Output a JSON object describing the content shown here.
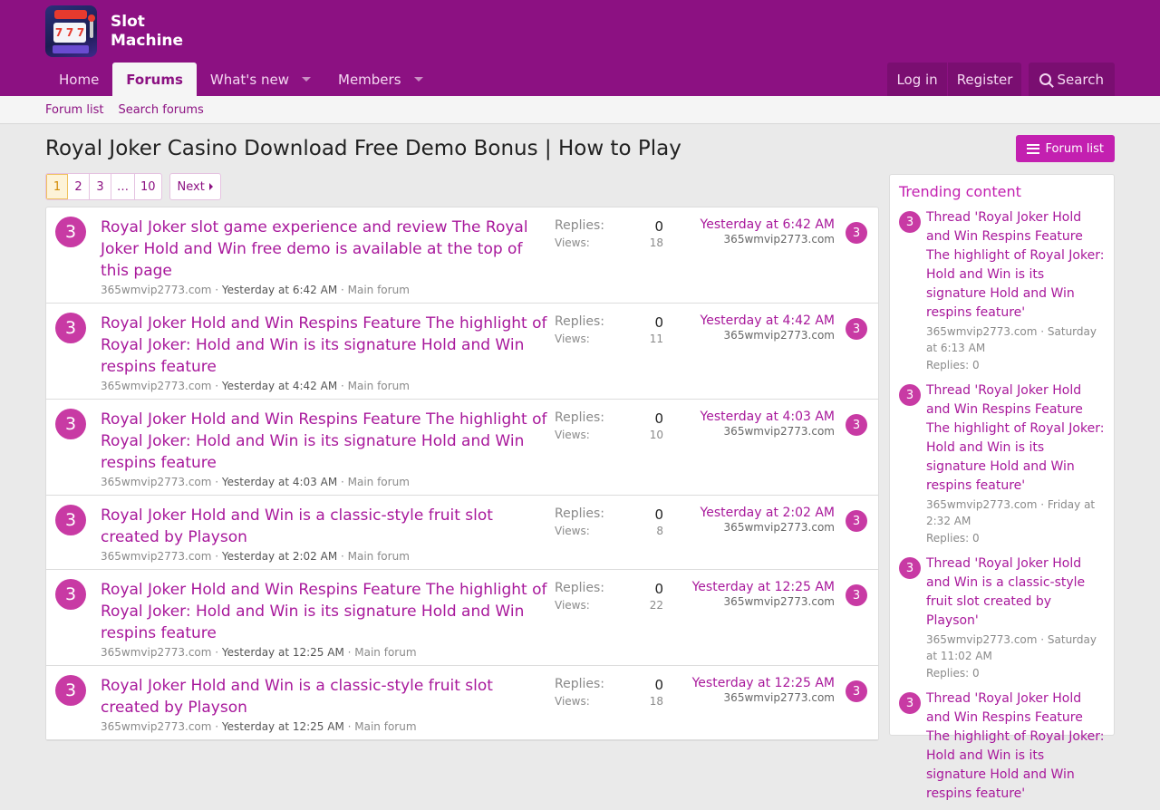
{
  "site": {
    "name_line1": "Slot",
    "name_line2": "Machine",
    "logo_reels": [
      "7",
      "7",
      "7"
    ]
  },
  "nav": {
    "items": [
      {
        "label": "Home"
      },
      {
        "label": "Forums"
      },
      {
        "label": "What's new"
      },
      {
        "label": "Members"
      }
    ],
    "login": "Log in",
    "register": "Register",
    "search": "Search"
  },
  "subnav": {
    "forum_list": "Forum list",
    "search_forums": "Search forums"
  },
  "page": {
    "title": "Royal Joker Casino Download Free Demo Bonus | How to Play",
    "forum_list_button": "Forum list"
  },
  "pager": {
    "pages": [
      "1",
      "2",
      "3",
      "…",
      "10"
    ],
    "next": "Next"
  },
  "threads": [
    {
      "avatar": "3",
      "title": "Royal Joker slot game experience and review The Royal Joker Hold and Win free demo is available at the top of this page",
      "author": "365wmvip2773.com",
      "date": "Yesterday at 6:42 AM",
      "forum": "Main forum",
      "replies_label": "Replies:",
      "replies": "0",
      "views_label": "Views:",
      "views": "18",
      "last_date": "Yesterday at 6:42 AM",
      "last_user": "365wmvip2773.com"
    },
    {
      "avatar": "3",
      "title": "Royal Joker Hold and Win Respins Feature The highlight of Royal Joker: Hold and Win is its signature Hold and Win respins feature",
      "author": "365wmvip2773.com",
      "date": "Yesterday at 4:42 AM",
      "forum": "Main forum",
      "replies_label": "Replies:",
      "replies": "0",
      "views_label": "Views:",
      "views": "11",
      "last_date": "Yesterday at 4:42 AM",
      "last_user": "365wmvip2773.com"
    },
    {
      "avatar": "3",
      "title": "Royal Joker Hold and Win Respins Feature The highlight of Royal Joker: Hold and Win is its signature Hold and Win respins feature",
      "author": "365wmvip2773.com",
      "date": "Yesterday at 4:03 AM",
      "forum": "Main forum",
      "replies_label": "Replies:",
      "replies": "0",
      "views_label": "Views:",
      "views": "10",
      "last_date": "Yesterday at 4:03 AM",
      "last_user": "365wmvip2773.com"
    },
    {
      "avatar": "3",
      "title": "Royal Joker Hold and Win is a classic-style fruit slot created by Playson",
      "author": "365wmvip2773.com",
      "date": "Yesterday at 2:02 AM",
      "forum": "Main forum",
      "replies_label": "Replies:",
      "replies": "0",
      "views_label": "Views:",
      "views": "8",
      "last_date": "Yesterday at 2:02 AM",
      "last_user": "365wmvip2773.com"
    },
    {
      "avatar": "3",
      "title": "Royal Joker Hold and Win Respins Feature The highlight of Royal Joker: Hold and Win is its signature Hold and Win respins feature",
      "author": "365wmvip2773.com",
      "date": "Yesterday at 12:25 AM",
      "forum": "Main forum",
      "replies_label": "Replies:",
      "replies": "0",
      "views_label": "Views:",
      "views": "22",
      "last_date": "Yesterday at 12:25 AM",
      "last_user": "365wmvip2773.com"
    },
    {
      "avatar": "3",
      "title": "Royal Joker Hold and Win is a classic-style fruit slot created by Playson",
      "author": "365wmvip2773.com",
      "date": "Yesterday at 12:25 AM",
      "forum": "Main forum",
      "replies_label": "Replies:",
      "replies": "0",
      "views_label": "Views:",
      "views": "18",
      "last_date": "Yesterday at 12:25 AM",
      "last_user": "365wmvip2773.com"
    }
  ],
  "sidebar": {
    "title": "Trending content",
    "items": [
      {
        "avatar": "3",
        "title": "Thread 'Royal Joker Hold and Win Respins Feature The highlight of Royal Joker: Hold and Win is its signature Hold and Win respins feature'",
        "meta": "365wmvip2773.com · Saturday at 6:13 AM",
        "replies": "Replies: 0"
      },
      {
        "avatar": "3",
        "title": "Thread 'Royal Joker Hold and Win Respins Feature The highlight of Royal Joker: Hold and Win is its signature Hold and Win respins feature'",
        "meta": "365wmvip2773.com · Friday at 2:32 AM",
        "replies": "Replies: 0"
      },
      {
        "avatar": "3",
        "title": "Thread 'Royal Joker Hold and Win is a classic-style fruit slot created by Playson'",
        "meta": "365wmvip2773.com · Saturday at 11:02 AM",
        "replies": "Replies: 0"
      },
      {
        "avatar": "3",
        "title": "Thread 'Royal Joker Hold and Win Respins Feature The highlight of Royal Joker: Hold and Win is its signature Hold and Win respins feature'",
        "meta": "",
        "replies": ""
      }
    ]
  },
  "colors": {
    "brand": "#8c1182",
    "accent": "#c320b0",
    "link": "#a8189b",
    "avatar": "#c83aa4"
  }
}
